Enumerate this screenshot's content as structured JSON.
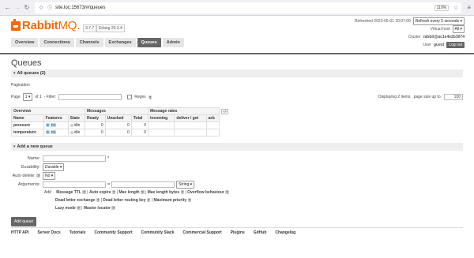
{
  "browser": {
    "url": "site.loc:15673/#/queues",
    "zoom": "110%"
  },
  "header": {
    "logo_prefix": "Rabbit",
    "logo_suffix": "MQ.",
    "version": "3.7.7",
    "erlang": "Erlang 20.3.4",
    "refreshed": "Refreshed 2023-05-01 20:07:00",
    "refresh_select": "Refresh every 5 seconds",
    "vhost_label": "Virtual host",
    "vhost_value": "All",
    "cluster_label": "Cluster",
    "cluster_value": "rabbit@ac1e4e2b3074",
    "user_label": "User",
    "user_value": "guest",
    "logout": "Log out"
  },
  "tabs": [
    "Overview",
    "Connections",
    "Channels",
    "Exchanges",
    "Queues",
    "Admin"
  ],
  "page_title": "Queues",
  "all_queues": "All queues (2)",
  "pagination": {
    "label": "Pagination",
    "page_label": "Page",
    "page_value": "1",
    "of_label": "of 1",
    "filter_label": "- Filter:",
    "regex_label": "Regex",
    "help": "?",
    "displaying": "Displaying 2 items , page size up to:",
    "page_size": "100"
  },
  "table": {
    "group_headers": [
      "Overview",
      "Messages",
      "Message rates"
    ],
    "columns": [
      "Name",
      "Features",
      "State",
      "Ready",
      "Unacked",
      "Total",
      "incoming",
      "deliver / get",
      "ack"
    ],
    "plusminus": "+/-",
    "rows": [
      {
        "name": "pressure",
        "features": [
          "D",
          "Pri"
        ],
        "state": "idle",
        "ready": "0",
        "unacked": "0",
        "total": "0"
      },
      {
        "name": "temperature",
        "features": [
          "D",
          "Pri"
        ],
        "state": "idle",
        "ready": "0",
        "unacked": "0",
        "total": "0"
      }
    ]
  },
  "add_queue": {
    "title": "Add a new queue",
    "name_label": "Name:",
    "required": "*",
    "durability_label": "Durability:",
    "durability_value": "Durable",
    "auto_delete_label": "Auto delete:",
    "help": "?",
    "auto_delete_value": "No",
    "arguments_label": "Arguments:",
    "equals": "=",
    "arg_type": "String",
    "add_label": "Add",
    "arg_links_row1": [
      "Message TTL",
      "Auto expire",
      "Max length",
      "Max length bytes",
      "Overflow behaviour"
    ],
    "arg_links_row2": [
      "Dead letter exchange",
      "Dead letter routing key",
      "Maximum priority"
    ],
    "arg_links_row3": [
      "Lazy mode",
      "Master locator"
    ],
    "button": "Add queue"
  },
  "footer": [
    "HTTP API",
    "Server Docs",
    "Tutorials",
    "Community Support",
    "Community Slack",
    "Commercial Support",
    "Plugins",
    "GitHub",
    "Changelog"
  ]
}
